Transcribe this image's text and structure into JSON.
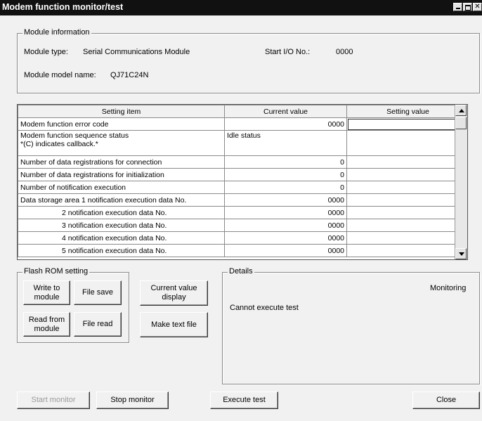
{
  "window": {
    "title": "Modem function monitor/test"
  },
  "module_info": {
    "legend": "Module information",
    "type_label": "Module type:",
    "type_value": "Serial Communications Module",
    "start_io_label": "Start I/O No.:",
    "start_io_value": "0000",
    "model_label": "Module model name:",
    "model_value": "QJ71C24N"
  },
  "grid": {
    "headers": [
      "Setting item",
      "Current value",
      "Setting value"
    ],
    "rows": [
      {
        "item": "Modem function error code",
        "current": "0000",
        "setting": ""
      },
      {
        "item": "Modem function sequence status",
        "item2": "*(C) indicates callback.*",
        "current": "Idle status",
        "setting": ""
      },
      {
        "item": "Number of data registrations for connection",
        "current": "0",
        "setting": ""
      },
      {
        "item": "Number of data registrations for initialization",
        "current": "0",
        "setting": ""
      },
      {
        "item": "Number of notification execution",
        "current": "0",
        "setting": ""
      },
      {
        "item": "Data storage area 1 notification execution data No.",
        "current": "0000",
        "setting": ""
      },
      {
        "item": "2 notification execution data No.",
        "current": "0000",
        "setting": ""
      },
      {
        "item": "3 notification execution data No.",
        "current": "0000",
        "setting": ""
      },
      {
        "item": "4 notification execution data No.",
        "current": "0000",
        "setting": ""
      },
      {
        "item": "5 notification execution data No.",
        "current": "0000",
        "setting": ""
      }
    ]
  },
  "flash_rom": {
    "legend": "Flash ROM setting",
    "write_label": "Write to module",
    "file_save_label": "File save",
    "read_label": "Read from module",
    "file_read_label": "File read"
  },
  "current_value_display_label": "Current value display",
  "make_text_file_label": "Make text file",
  "details": {
    "legend": "Details",
    "status": "Monitoring",
    "message": "Cannot execute test"
  },
  "bottom": {
    "start_monitor": "Start monitor",
    "stop_monitor": "Stop monitor",
    "execute_test": "Execute test",
    "close": "Close"
  }
}
